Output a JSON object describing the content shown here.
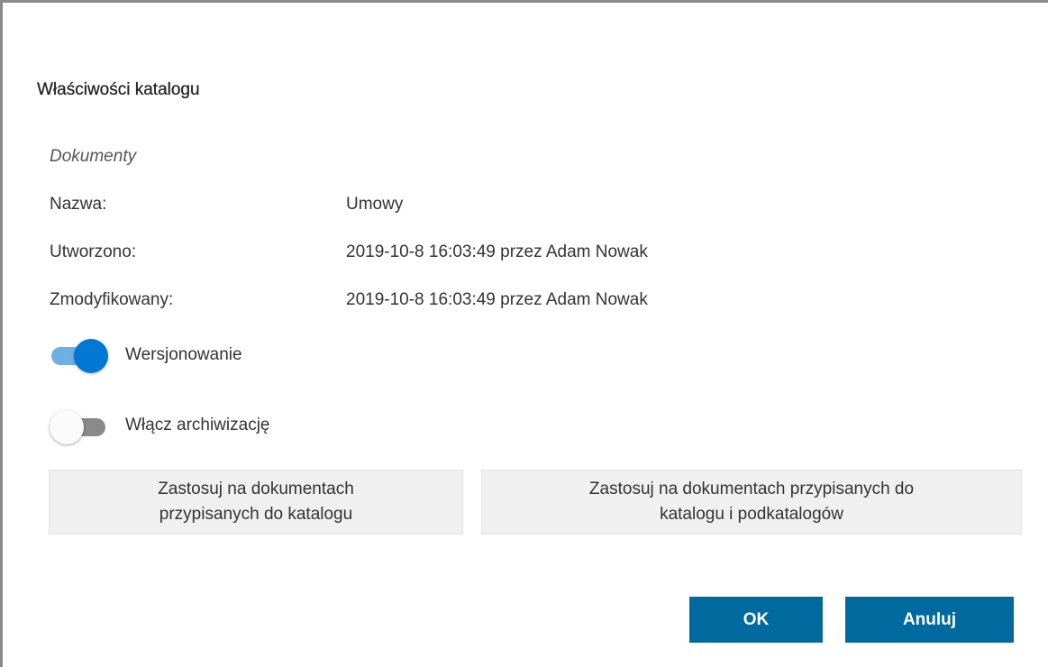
{
  "dialog": {
    "title": "Właściwości katalogu",
    "subtitle": "Dokumenty"
  },
  "properties": [
    {
      "label": "Nazwa:",
      "value": "Umowy"
    },
    {
      "label": "Utworzono:",
      "value": "2019-10-8 16:03:49 przez Adam Nowak"
    },
    {
      "label": "Zmodyfikowany:",
      "value": "2019-10-8 16:03:49 przez Adam Nowak"
    }
  ],
  "toggles": {
    "versioning": {
      "label": "Wersjonowanie",
      "checked": true
    },
    "archiving": {
      "label": "Włącz archiwizację",
      "checked": false
    }
  },
  "apply_buttons": {
    "folder": {
      "line1": "Zastosuj na dokumentach",
      "line2": "przypisanych do katalogu"
    },
    "folder_and_subfolders": {
      "line1": "Zastosuj na dokumentach przypisanych do",
      "line2": "katalogu i podkatalogów"
    }
  },
  "footer": {
    "ok_label": "OK",
    "cancel_label": "Anuluj"
  },
  "colors": {
    "primary": "#006a9e",
    "toggle_on": "#0078d4",
    "toggle_off": "#8a8a8a"
  }
}
